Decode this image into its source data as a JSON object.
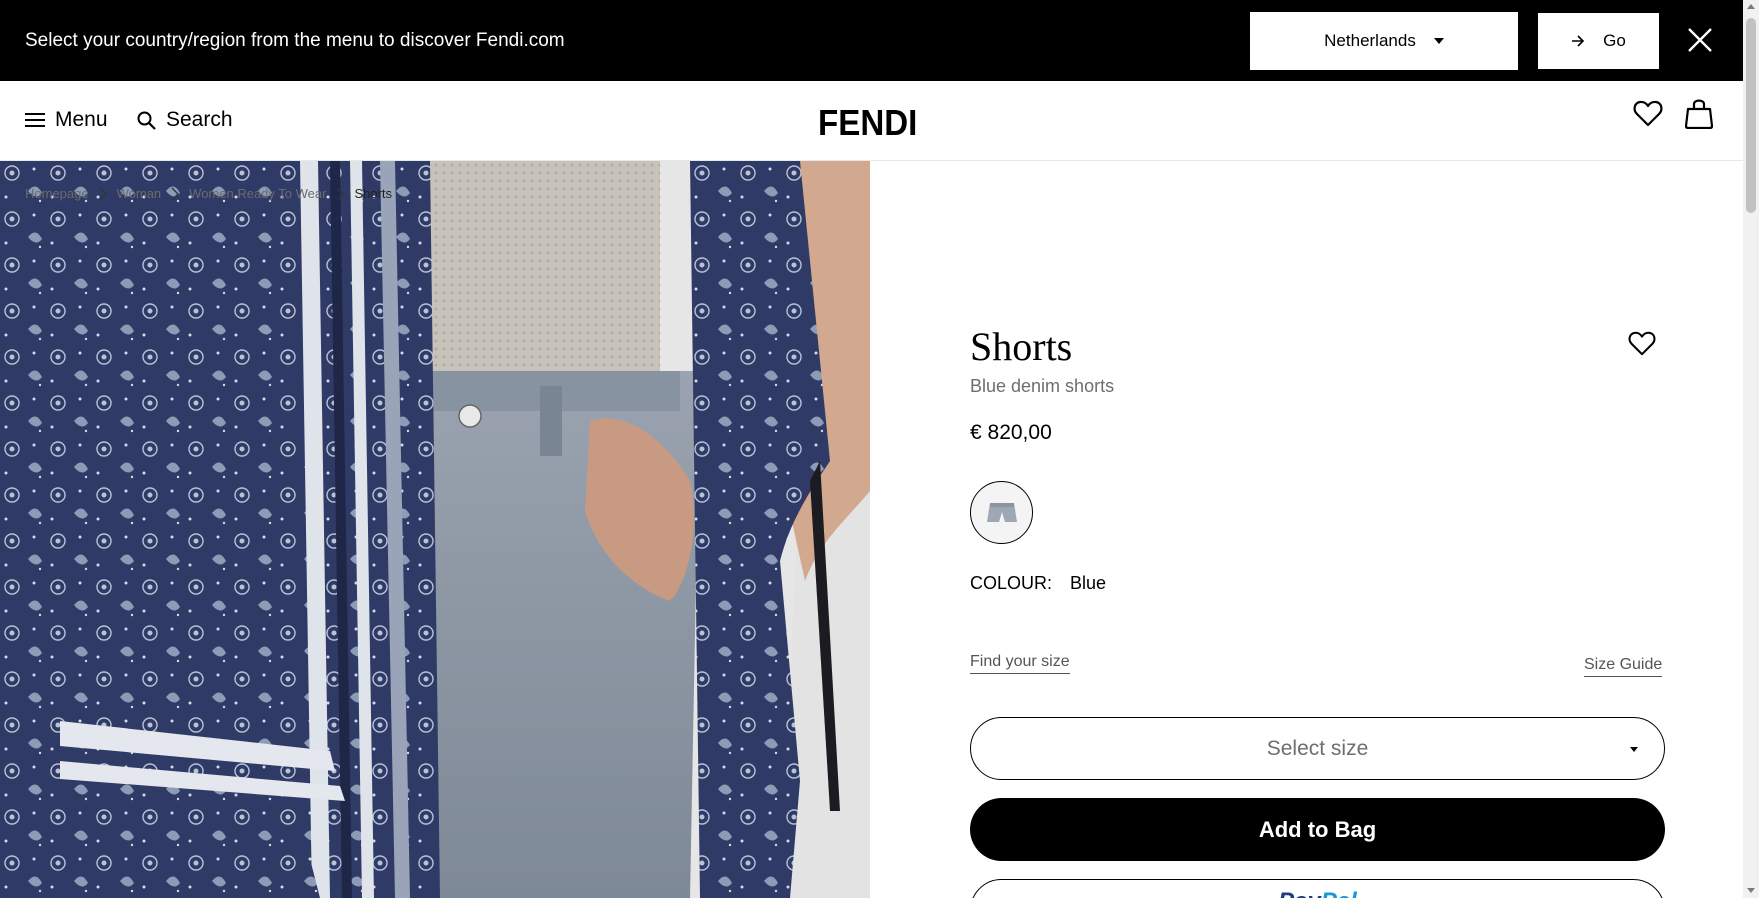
{
  "banner": {
    "message": "Select your country/region from the menu to discover Fendi.com",
    "country_value": "Netherlands",
    "go_label": "Go"
  },
  "header": {
    "menu_label": "Menu",
    "search_label": "Search",
    "logo_text": "FENDI"
  },
  "breadcrumb": [
    "Homepage",
    "Woman",
    "Women Ready To Wear",
    "Shorts"
  ],
  "product": {
    "title": "Shorts",
    "subtitle": "Blue denim shorts",
    "price": "€ 820,00",
    "colour_label": "COLOUR:",
    "colour_value": "Blue",
    "find_size_label": "Find your size",
    "size_guide_label": "Size Guide",
    "size_placeholder": "Select size",
    "add_to_bag_label": "Add to Bag",
    "paypal_pay": "Pay",
    "paypal_pal": "Pal"
  },
  "colors": {
    "banner_bg": "#000000",
    "primary_button": "#000000",
    "scarf_navy": "#2d3a63",
    "denim": "#8d99a8"
  },
  "icons": [
    "close-icon",
    "hamburger-icon",
    "search-icon",
    "heart-icon",
    "shopping-bag-icon",
    "arrow-right-icon",
    "chevron-right-icon",
    "caret-down-icon"
  ]
}
